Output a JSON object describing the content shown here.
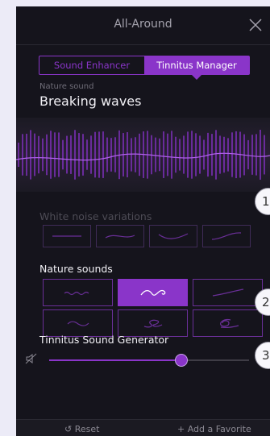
{
  "header": {
    "title": "All-Around"
  },
  "tabs": [
    {
      "label": "Sound Enhancer",
      "active": false
    },
    {
      "label": "Tinnitus Manager",
      "active": true
    }
  ],
  "nature_sound": {
    "caption": "Nature sound",
    "name": "Breaking waves"
  },
  "white_noise": {
    "label": "White noise variations",
    "count": 4,
    "enabled": false
  },
  "nature_sounds": {
    "label": "Nature sounds",
    "count": 6,
    "selected_index": 1
  },
  "generator": {
    "label": "Tinnitus Sound Generator",
    "volume_fraction": 0.66,
    "icon": "speaker-muted-icon"
  },
  "footer": {
    "reset": "Reset",
    "favorite": "Add a Favorite"
  },
  "callouts": [
    "1",
    "2",
    "3"
  ],
  "colors": {
    "accent": "#8a35c9",
    "background": "#15141c",
    "page": "#ecebf7"
  }
}
